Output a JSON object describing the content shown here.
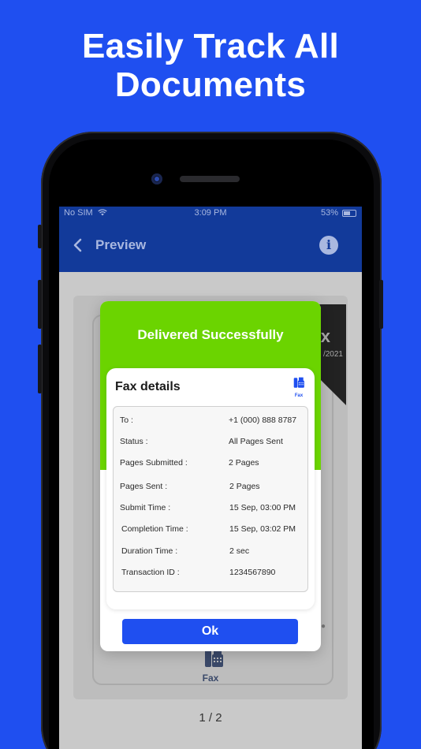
{
  "headline": {
    "line1": "Easily Track All",
    "line2": "Documents"
  },
  "status_bar": {
    "carrier": "No SIM",
    "time": "3:09 PM",
    "battery": "53%"
  },
  "nav": {
    "title": "Preview"
  },
  "background_doc": {
    "fax_label": "Fax",
    "partial_year": "/2021",
    "partial_letter": "x"
  },
  "pager": "1 / 2",
  "modal": {
    "title": "Delivered Successfully",
    "details_title": "Fax details",
    "fax_icon_label": "Fax",
    "rows": [
      {
        "label": "To :",
        "value": "+1 (000) 888 8787"
      },
      {
        "label": "Status :",
        "value": "All Pages Sent"
      },
      {
        "label": "Pages Submitted :",
        "value": "2 Pages"
      },
      {
        "label": "Pages Sent :",
        "value": "2 Pages"
      },
      {
        "label": "Submit Time :",
        "value": "15 Sep, 03:00 PM"
      },
      {
        "label": "Completion Time :",
        "value": "15 Sep, 03:02 PM"
      },
      {
        "label": "Duration Time :",
        "value": "2 sec"
      },
      {
        "label": "Transaction ID :",
        "value": "1234567890"
      }
    ],
    "ok_label": "Ok"
  },
  "colors": {
    "background": "#1f4ff0",
    "navbar": "#123a9a",
    "success_green": "#6bd400",
    "button_blue": "#1f4ff0"
  },
  "icons": [
    "back-chevron-icon",
    "info-icon",
    "fax-icon",
    "wifi-icon",
    "battery-icon"
  ]
}
